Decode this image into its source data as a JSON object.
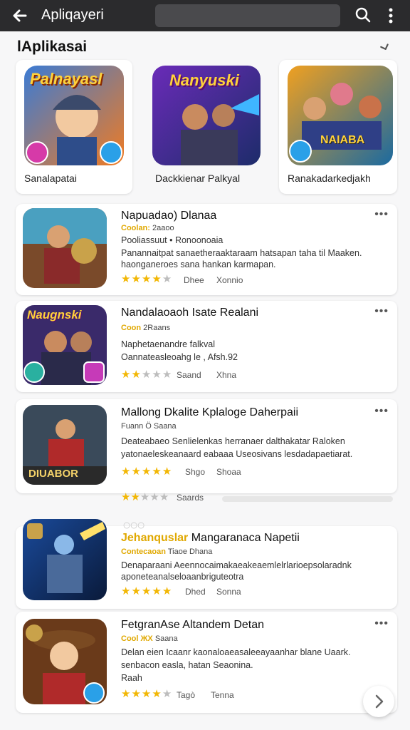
{
  "header": {
    "title": "Apliqayeri"
  },
  "section": {
    "title": "lAplikasai"
  },
  "featured": [
    {
      "name": "Sanalapatai",
      "art_text": "Palnayasl"
    },
    {
      "name": "Dackkienar Palkyal",
      "art_text": "Nanyuski"
    },
    {
      "name": "Ranakadarkedjakh",
      "art_text": "NAIABA"
    }
  ],
  "cards": [
    {
      "title": "Napuadao) Dlanaa",
      "meta_hi": "Coolan:",
      "meta": "2ааоо",
      "line1": "Pooliassuut  •  Ronoonoaia",
      "line2": "Panannaitpat sanaetheraaktaraam hatsapan taha til Maaken.",
      "line3": "haonganeroes sana hankan karmapan.",
      "rating": 4,
      "stat1": "Dhee",
      "stat2": "Xonnio",
      "art_text": ""
    },
    {
      "title": "Nandalaoaoh Isate Realani",
      "meta_hi": "Coon",
      "meta": "2Raans",
      "line1": "Naphetaenandre falkval",
      "line2": "Oannateasleoahg le , Afsh.92",
      "rating": 2,
      "stat1": "Saand",
      "stat2": "Xhna",
      "art_text": "Naugnski"
    },
    {
      "title": "Mallong Dkalite Kplaloge Daherpaii",
      "meta": "Fuann  Ö  Saana",
      "line2": "Deateabaeo Senlielenkas herranaer dalthakatar Raloken",
      "line3": "yatonaeleskeanaard eabaaa Useosivans lesdadapaetiarat.",
      "rating": 5,
      "stat1": "Shgo",
      "stat2": "Shoaa",
      "art_text": "DIUABOR"
    },
    {
      "title": "Mangaranaca Napetii",
      "title_hi": "Jehanquslar",
      "meta_hi": "Contecaoan",
      "meta": "Tiaoe Dhana",
      "line2": "Denaparaani Aeennocaimakaeakeaemlelrlarioepsolaradnk",
      "line3": "aponeteanalseloaanbriguteotra",
      "rating": 5,
      "stat1": "Dhed",
      "stat2": "Sonna",
      "art_text": ""
    },
    {
      "title": "FetgranAse Altandem Detan",
      "meta_hi": "Cool  ЖХ",
      "meta": "Saana",
      "line2": "Delan eien  Icaanr kaonaloaeasaleeayaanhar blane Uaark.",
      "line3": "senbacon easla, hatan Seaonina.",
      "line4": "Raah",
      "rating": 4,
      "stat1": "Tagò",
      "stat2": "Tenna",
      "art_text": ""
    }
  ],
  "partial_row": {
    "rating": 2,
    "label": "Saards"
  },
  "colors": {
    "star": "#f2b705",
    "accent": "#e0a800",
    "topbar": "#2b2b2d"
  }
}
